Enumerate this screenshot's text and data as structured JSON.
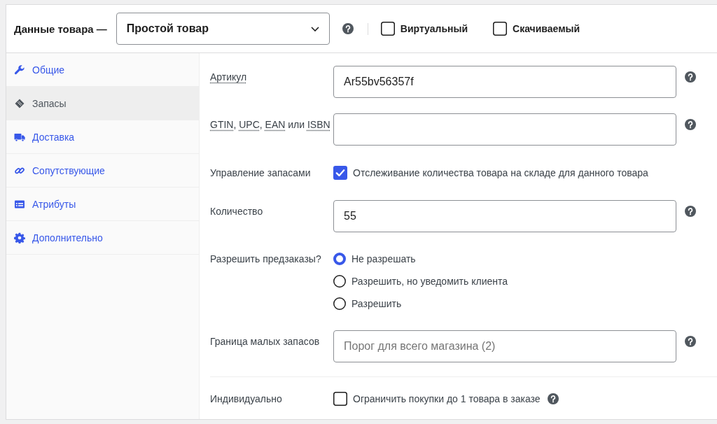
{
  "header": {
    "title": "Данные товара —",
    "product_type": "Простой товар",
    "help": true,
    "options": [
      {
        "label": "Виртуальный",
        "checked": false
      },
      {
        "label": "Скачиваемый",
        "checked": false
      }
    ]
  },
  "sidebar": {
    "items": [
      {
        "label": "Общие",
        "selected": false
      },
      {
        "label": "Запасы",
        "selected": true
      },
      {
        "label": "Доставка",
        "selected": false
      },
      {
        "label": "Сопутствующие",
        "selected": false
      },
      {
        "label": "Атрибуты",
        "selected": false
      },
      {
        "label": "Дополнительно",
        "selected": false
      }
    ]
  },
  "sections": [
    {
      "fields": [
        {
          "kind": "text",
          "label": [
            {
              "text": "Артикул",
              "abbr": true
            }
          ],
          "value": "Ar55bv56357f",
          "help": true
        },
        {
          "kind": "text",
          "label": [
            {
              "text": "GTIN",
              "abbr": true
            },
            {
              "text": ", ",
              "abbr": false
            },
            {
              "text": "UPC",
              "abbr": true
            },
            {
              "text": ", ",
              "abbr": false
            },
            {
              "text": "EAN",
              "abbr": true
            },
            {
              "text": " или ",
              "abbr": false
            },
            {
              "text": "ISBN",
              "abbr": true
            }
          ],
          "help": true
        },
        {
          "kind": "checkbox",
          "label": [
            {
              "text": "Управление запасами",
              "abbr": false
            }
          ],
          "text": "Отслеживание количества товара на складе для данного товара",
          "checked": true,
          "help": false
        },
        {
          "kind": "text",
          "label": [
            {
              "text": "Количество",
              "abbr": false
            }
          ],
          "value": "55",
          "help": true
        },
        {
          "kind": "radio",
          "label": [
            {
              "text": "Разрешить предзаказы?",
              "abbr": false
            }
          ],
          "options": [
            {
              "label": "Не разрешать",
              "selected": true
            },
            {
              "label": "Разрешить, но уведомить клиента",
              "selected": false
            },
            {
              "label": "Разрешить",
              "selected": false
            }
          ],
          "help": false
        },
        {
          "kind": "text",
          "label": [
            {
              "text": "Граница малых запасов",
              "abbr": false
            }
          ],
          "placeholder": "Порог для всего магазина (2)",
          "help": true
        }
      ]
    },
    {
      "fields": [
        {
          "kind": "checkbox",
          "label": [
            {
              "text": "Индивидуально",
              "abbr": false
            }
          ],
          "text": "Ограничить покупки до 1 товара в заказе",
          "checked": false,
          "help": true
        }
      ]
    }
  ]
}
